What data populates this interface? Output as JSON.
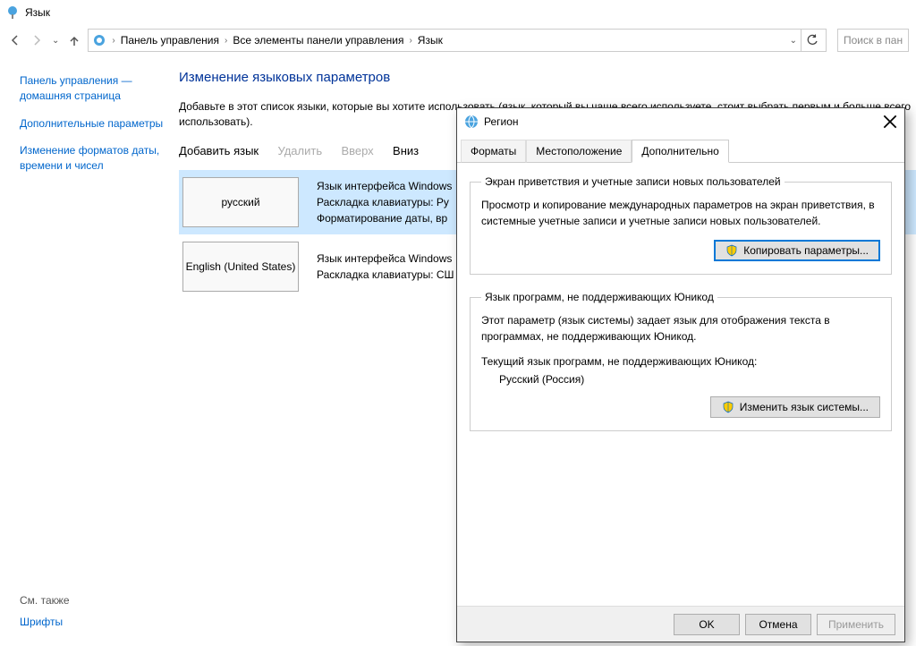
{
  "window": {
    "title": "Язык"
  },
  "breadcrumb": {
    "items": [
      "Панель управления",
      "Все элементы панели управления",
      "Язык"
    ]
  },
  "search": {
    "placeholder": "Поиск в пан"
  },
  "sidebar": {
    "links": [
      "Панель управления — домашняя страница",
      "Дополнительные параметры",
      "Изменение форматов даты, времени и чисел"
    ],
    "see_also_label": "См. также",
    "see_also_items": [
      "Шрифты"
    ]
  },
  "page": {
    "title": "Изменение языковых параметров",
    "subtitle": "Добавьте в этот список языки, которые вы хотите использовать (язык, который вы чаще всего используете, стоит выбрать первым и больше всего использовать)."
  },
  "toolbar": {
    "add": "Добавить язык",
    "remove": "Удалить",
    "up": "Вверх",
    "down": "Вниз"
  },
  "languages": [
    {
      "name": "русский",
      "details": "Язык интерфейса Windows\nРаскладка клавиатуры: Ру\nФорматирование даты, вр",
      "selected": true
    },
    {
      "name": "English (United States)",
      "details": "Язык интерфейса Windows\nРаскладка клавиатуры: СШ",
      "selected": false
    }
  ],
  "dialog": {
    "title": "Регион",
    "tabs": [
      "Форматы",
      "Местоположение",
      "Дополнительно"
    ],
    "active_tab": 2,
    "group1": {
      "legend": "Экран приветствия и учетные записи новых пользователей",
      "text": "Просмотр и копирование международных параметров на экран приветствия, в системные учетные записи и учетные записи новых пользователей.",
      "button": "Копировать параметры..."
    },
    "group2": {
      "legend": "Язык программ, не поддерживающих Юникод",
      "text": "Этот параметр (язык системы) задает язык для отображения текста в программах, не поддерживающих Юникод.",
      "current_label": "Текущий язык программ, не поддерживающих Юникод:",
      "current_value": "Русский (Россия)",
      "button": "Изменить язык системы..."
    },
    "footer": {
      "ok": "OK",
      "cancel": "Отмена",
      "apply": "Применить"
    }
  }
}
